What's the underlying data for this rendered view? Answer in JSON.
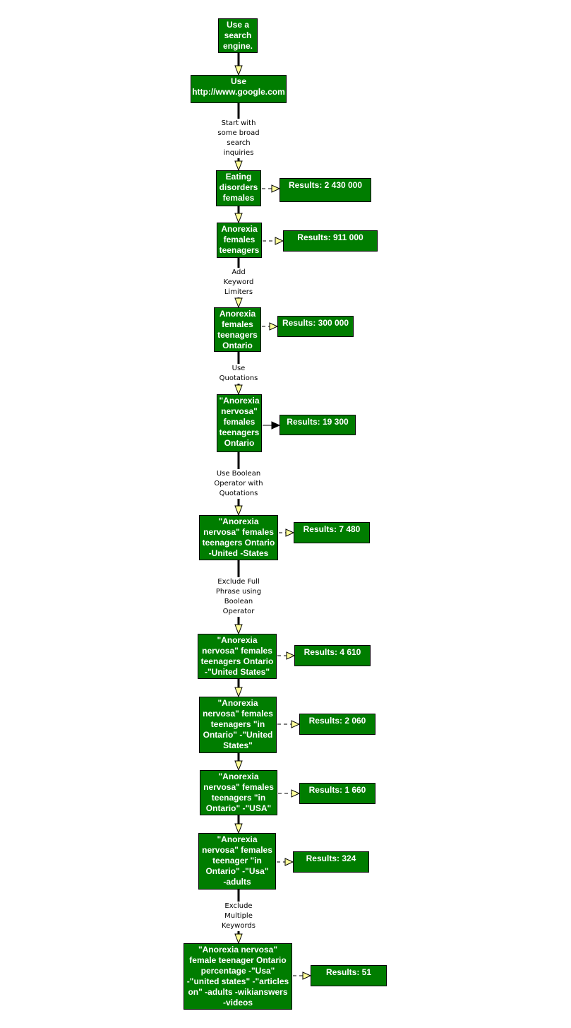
{
  "nodes": [
    {
      "text": "Use a\nsearch\nengine."
    },
    {
      "text": "Use\nhttp://www.google.com"
    },
    {
      "text": "Eating\ndisorders\nfemales",
      "result": "Results: 2 430 000"
    },
    {
      "text": "Anorexia\nfemales\nteenagers",
      "result": "Results: 911 000"
    },
    {
      "text": "Anorexia\nfemales\nteenagers\nOntario",
      "result": "Results: 300 000"
    },
    {
      "text": "\"Anorexia\nnervosa\"\nfemales\nteenagers\nOntario",
      "result": "Results: 19 300"
    },
    {
      "text": "\"Anorexia\nnervosa\" females\nteenagers Ontario\n-United -States",
      "result": "Results: 7 480"
    },
    {
      "text": "\"Anorexia\nnervosa\" females\nteenagers Ontario\n-\"United States\"",
      "result": "Results: 4 610"
    },
    {
      "text": "\"Anorexia\nnervosa\" females\nteenagers \"in\nOntario\" -\"United\nStates\"",
      "result": "Results: 2 060"
    },
    {
      "text": "\"Anorexia\nnervosa\" females\nteenagers \"in\nOntario\" -\"USA\"",
      "result": "Results: 1 660"
    },
    {
      "text": "\"Anorexia\nnervosa\" females\nteenager \"in\nOntario\" -\"Usa\"\n-adults",
      "result": "Results: 324"
    },
    {
      "text": "\"Anorexia nervosa\"\nfemale teenager Ontario\npercentage -\"Usa\"\n-\"united states\" -\"articles\non\" -adults -wikianswers\n-videos",
      "result": "Results: 51"
    }
  ],
  "edge_labels": [
    {
      "text": "Start with\nsome broad\nsearch\ninquiries"
    },
    {
      "text": "Add\nKeyword\nLimiters"
    },
    {
      "text": "Use\nQuotations"
    },
    {
      "text": "Use Boolean\nOperator with\nQuotations"
    },
    {
      "text": "Exclude Full\nPhrase using\nBoolean\nOperator"
    },
    {
      "text": "Exclude\nMultiple\nKeywords"
    }
  ],
  "colors": {
    "node_fill": "#007d00",
    "arrow_fill": "#ffff99",
    "text": "#ffffff"
  }
}
